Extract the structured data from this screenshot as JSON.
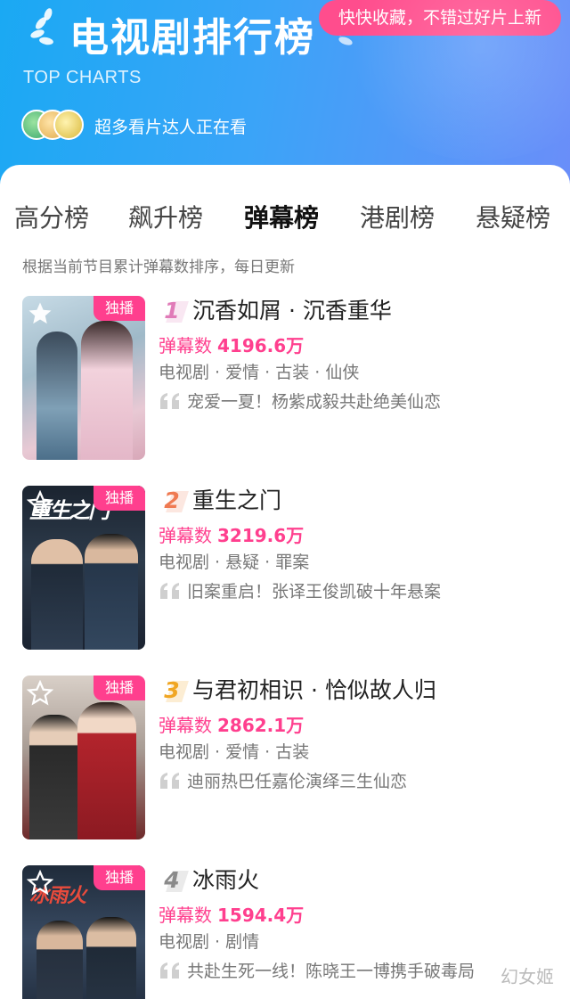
{
  "header": {
    "title": "电视剧排行榜",
    "subtitle": "TOP CHARTS",
    "promo": "快快收藏，不错过好片上新",
    "viewers_text": "超多看片达人正在看"
  },
  "tabs": [
    {
      "label": "高分榜",
      "active": false
    },
    {
      "label": "飙升榜",
      "active": false
    },
    {
      "label": "弹幕榜",
      "active": true
    },
    {
      "label": "港剧榜",
      "active": false
    },
    {
      "label": "悬疑榜",
      "active": false
    }
  ],
  "description": "根据当前节目累计弹幕数排序，每日更新",
  "items": [
    {
      "rank": "1",
      "rank_color": "#e07bb8",
      "title": "沉香如屑 · 沉香重华",
      "badge": "独播",
      "metric_label": "弹幕数",
      "metric_value": "4196.6万",
      "tags": "电视剧 · 爱情 · 古装 · 仙侠",
      "quote": "宠爱一夏！杨紫成毅共赴绝美仙恋"
    },
    {
      "rank": "2",
      "rank_color": "#ef7a52",
      "title": "重生之门",
      "badge": "独播",
      "metric_label": "弹幕数",
      "metric_value": "3219.6万",
      "tags": "电视剧 · 悬疑 · 罪案",
      "quote": "旧案重启！张译王俊凯破十年悬案"
    },
    {
      "rank": "3",
      "rank_color": "#f0a623",
      "title": "与君初相识 · 恰似故人归",
      "badge": "独播",
      "metric_label": "弹幕数",
      "metric_value": "2862.1万",
      "tags": "电视剧 · 爱情 · 古装",
      "quote": "迪丽热巴任嘉伦演绎三生仙恋"
    },
    {
      "rank": "4",
      "rank_color": "#8a8a8a",
      "title": "冰雨火",
      "badge": "独播",
      "metric_label": "弹幕数",
      "metric_value": "1594.4万",
      "tags": "电视剧 · 剧情",
      "quote": "共赴生死一线！陈晓王一博携手破毒局"
    }
  ],
  "watermark": "幻女姬",
  "colors": {
    "accent": "#ff3f8e",
    "header_start": "#1aa9f3",
    "header_end": "#6a8ef9"
  },
  "icons": [
    "laurel-icon",
    "avatar-group",
    "star-icon",
    "quote-icon"
  ]
}
